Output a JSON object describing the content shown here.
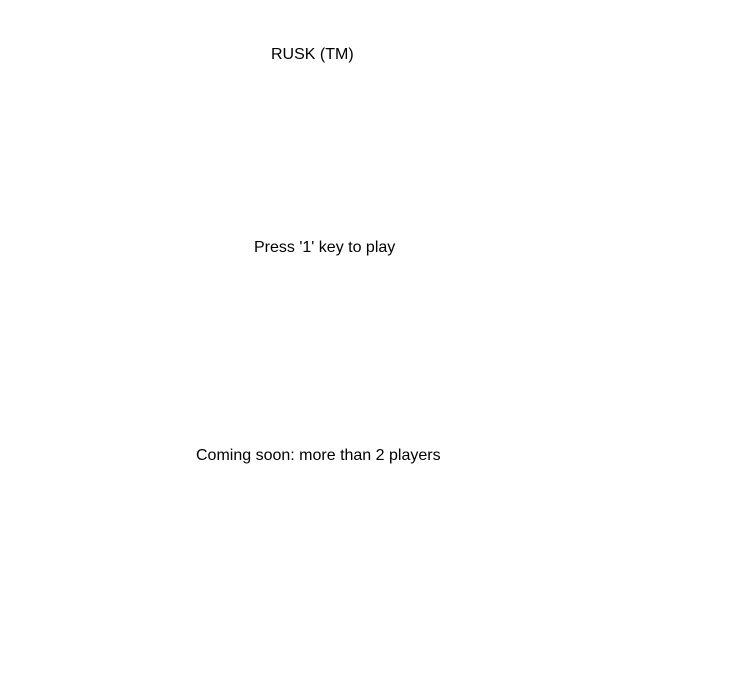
{
  "game": {
    "title": "RUSK (TM)",
    "start_prompt": "Press '1' key to play",
    "coming_soon": "Coming soon: more than 2 players"
  },
  "colors": {
    "background": "#ffffff",
    "text": "#000000"
  }
}
